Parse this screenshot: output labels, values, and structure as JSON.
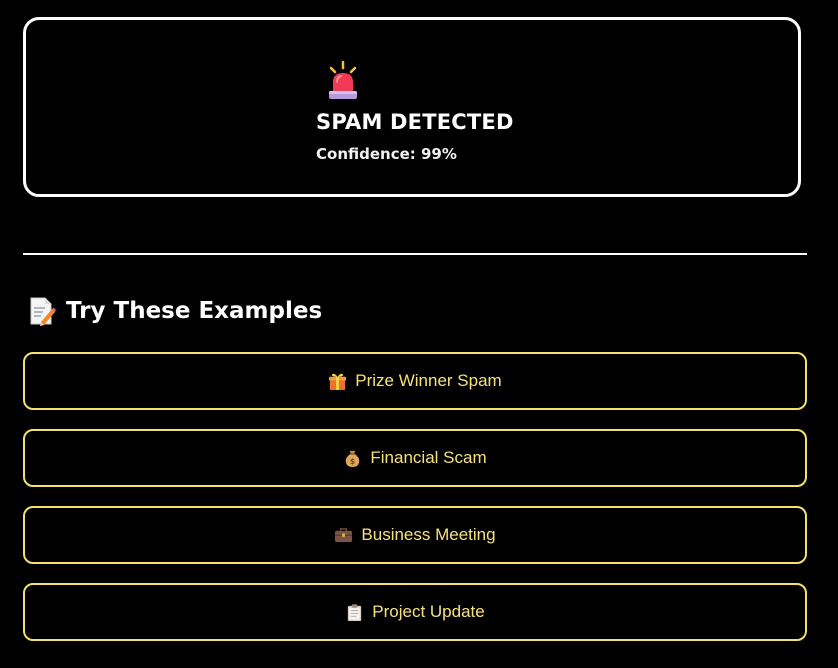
{
  "result": {
    "icon": "police-siren-icon",
    "title": "SPAM DETECTED",
    "confidence": "Confidence: 99%"
  },
  "examples": {
    "icon": "memo-icon",
    "title": "Try These Examples",
    "accent": "#f5e06a",
    "buttons": [
      {
        "icon": "gift-icon",
        "label": "Prize Winner Spam"
      },
      {
        "icon": "money-bag-icon",
        "label": "Financial Scam"
      },
      {
        "icon": "briefcase-icon",
        "label": "Business Meeting"
      },
      {
        "icon": "clipboard-icon",
        "label": "Project Update"
      }
    ]
  }
}
